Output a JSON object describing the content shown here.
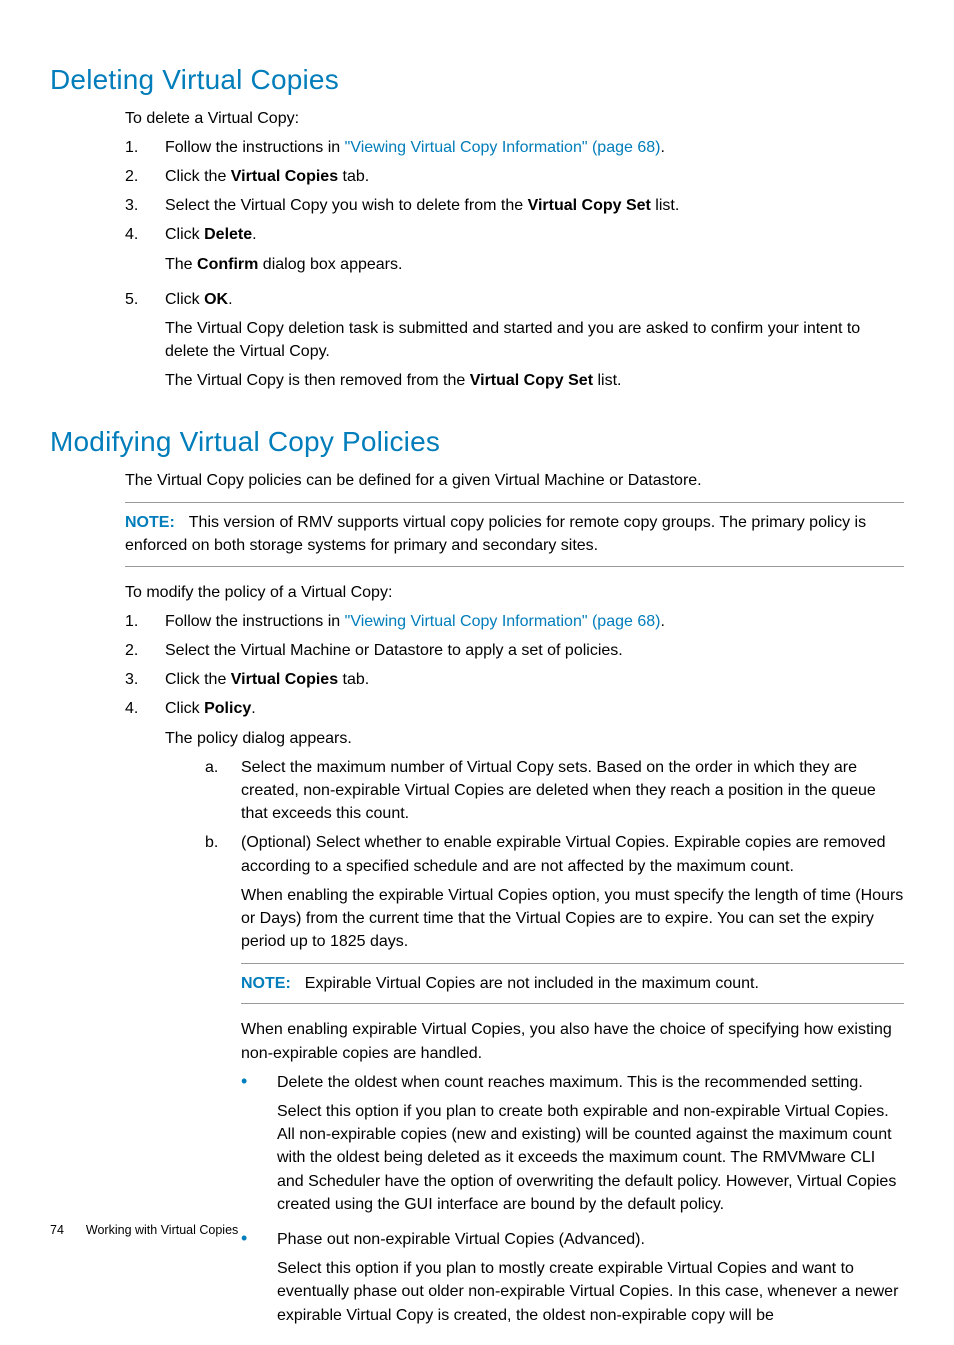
{
  "footer": {
    "page": "74",
    "title": "Working with Virtual Copies"
  },
  "s1": {
    "heading": "Deleting Virtual Copies",
    "intro": "To delete a Virtual Copy:",
    "steps": [
      {
        "n": "1.",
        "pre": "Follow the instructions in ",
        "link": "\"Viewing Virtual Copy Information\" (page 68)",
        "post": "."
      },
      {
        "n": "2.",
        "a": "Click the ",
        "b": "Virtual Copies",
        "c": " tab."
      },
      {
        "n": "3.",
        "a": "Select the Virtual Copy you wish to delete from the ",
        "b": "Virtual Copy Set",
        "c": " list."
      },
      {
        "n": "4.",
        "a": "Click ",
        "b": "Delete",
        "c": ".",
        "sub1a": "The ",
        "sub1b": "Confirm",
        "sub1c": " dialog box appears."
      },
      {
        "n": "5.",
        "a": "Click ",
        "b": "OK",
        "c": ".",
        "sub1": "The Virtual Copy deletion task is submitted and started and you are asked to confirm your intent to delete the Virtual Copy.",
        "sub2a": "The Virtual Copy is then removed from the ",
        "sub2b": "Virtual Copy Set",
        "sub2c": " list."
      }
    ]
  },
  "s2": {
    "heading": "Modifying Virtual Copy Policies",
    "intro": "The Virtual Copy policies can be defined for a given Virtual Machine or Datastore.",
    "note1": {
      "label": "NOTE:",
      "text": "This version of RMV supports virtual copy policies for remote copy groups. The primary policy is enforced on both storage systems for primary and secondary sites."
    },
    "lead": "To modify the policy of a Virtual Copy:",
    "steps": {
      "s1": {
        "n": "1.",
        "pre": "Follow the instructions in ",
        "link": "\"Viewing Virtual Copy Information\" (page 68)",
        "post": "."
      },
      "s2": {
        "n": "2.",
        "text": "Select the Virtual Machine or Datastore to apply a set of policies."
      },
      "s3": {
        "n": "3.",
        "a": "Click the ",
        "b": "Virtual Copies",
        "c": " tab."
      },
      "s4": {
        "n": "4.",
        "a": "Click ",
        "b": "Policy",
        "c": ".",
        "sub1": "The policy dialog appears.",
        "a_item": {
          "n": "a.",
          "text": "Select the maximum number of Virtual Copy sets. Based on the order in which they are created, non-expirable Virtual Copies are deleted when they reach a position in the queue that exceeds this count."
        },
        "b_item": {
          "n": "b.",
          "text": "(Optional) Select whether to enable expirable Virtual Copies. Expirable copies are removed according to a specified schedule and are not affected by the maximum count.",
          "p1": "When enabling the expirable Virtual Copies option, you must specify the length of time (Hours or Days) from the current time that the Virtual Copies are to expire. You can set the expiry period up to 1825 days.",
          "note": {
            "label": "NOTE:",
            "text": "Expirable Virtual Copies are not included in the maximum count."
          },
          "p2": "When enabling expirable Virtual Copies, you also have the choice of specifying how existing non-expirable copies are handled.",
          "bul1": {
            "head": "Delete the oldest when count reaches maximum. This is the recommended setting.",
            "body": "Select this option if you plan to create both expirable and non-expirable Virtual Copies. All non-expirable copies (new and existing) will be counted against the maximum count with the oldest being deleted as it exceeds the maximum count. The RMVMware CLI and Scheduler have the option of overwriting the default policy. However, Virtual Copies created using the GUI interface are bound by the default policy."
          },
          "bul2": {
            "head": "Phase out non-expirable Virtual Copies (Advanced).",
            "body": "Select this option if you plan to mostly create expirable Virtual Copies and want to eventually phase out older non-expirable Virtual Copies. In this case, whenever a newer expirable Virtual Copy is created, the oldest non-expirable copy will be"
          }
        }
      }
    }
  }
}
